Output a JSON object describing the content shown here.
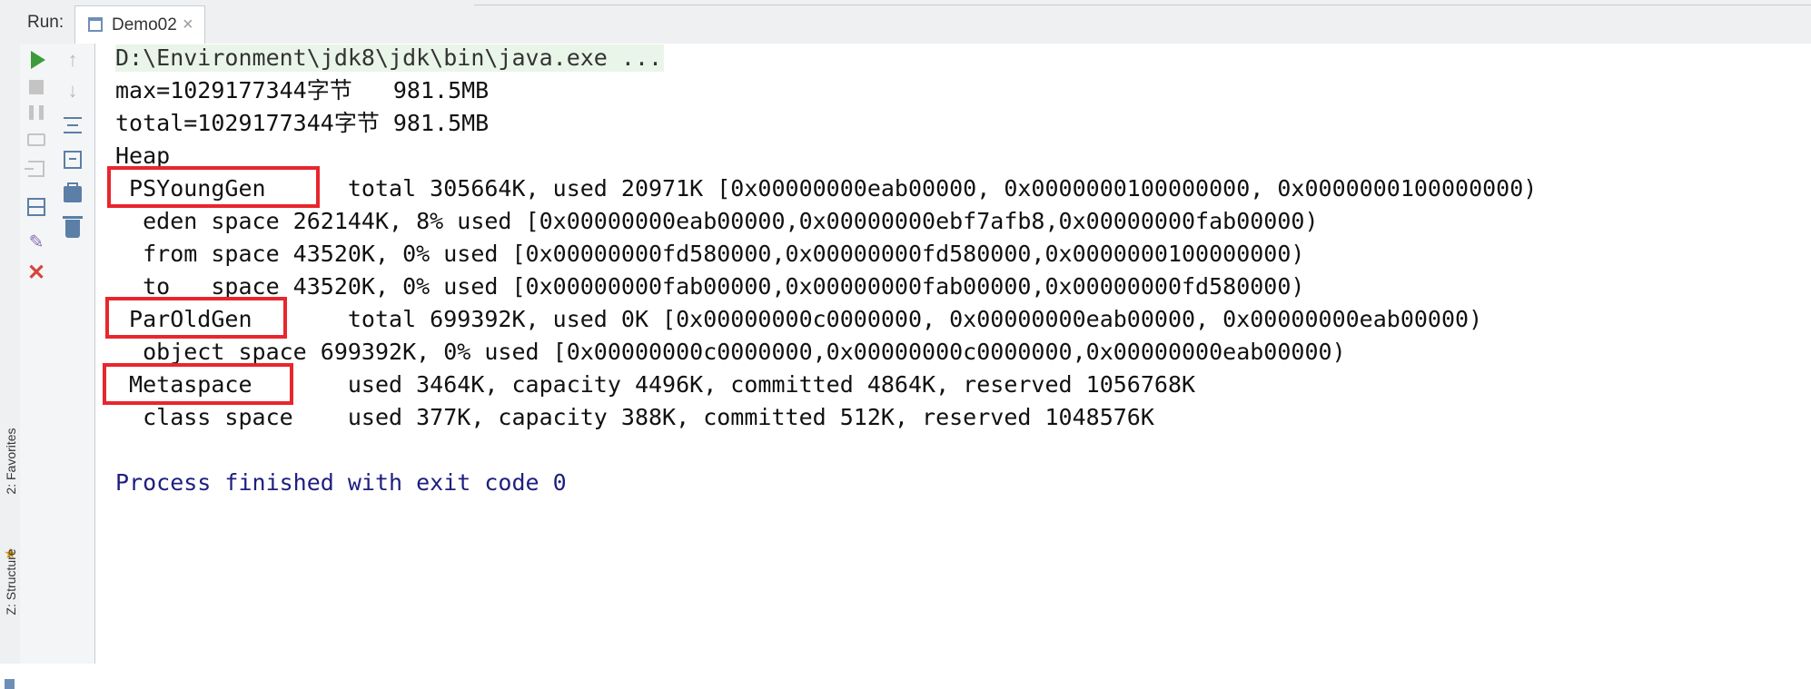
{
  "run_bar": {
    "label": "Run:",
    "tab_label": "Demo02",
    "tab_close": "×"
  },
  "side_tabs": {
    "favorites": "2: Favorites",
    "structure": "Z: Structure"
  },
  "toolbar_icons": [
    "play-icon",
    "stop-icon",
    "pause-icon",
    "camera-icon",
    "exit-icon",
    "layout-icon",
    "pin-icon",
    "close-icon",
    "arrow-up-icon",
    "arrow-down-icon",
    "soft-wrap-icon",
    "scroll-to-end-icon",
    "print-icon",
    "trash-icon"
  ],
  "colors": {
    "highlight_box": "#e8262d",
    "run_green": "#3d9b3d",
    "finish_text": "#1e1e80"
  },
  "console": {
    "lines": [
      "D:\\Environment\\jdk8\\jdk\\bin\\java.exe ...",
      "max=1029177344字节   981.5MB",
      "total=1029177344字节 981.5MB",
      "Heap",
      " PSYoungGen      total 305664K, used 20971K [0x00000000eab00000, 0x0000000100000000, 0x0000000100000000)",
      "  eden space 262144K, 8% used [0x00000000eab00000,0x00000000ebf7afb8,0x00000000fab00000)",
      "  from space 43520K, 0% used [0x00000000fd580000,0x00000000fd580000,0x0000000100000000)",
      "  to   space 43520K, 0% used [0x00000000fab00000,0x00000000fab00000,0x00000000fd580000)",
      " ParOldGen       total 699392K, used 0K [0x00000000c0000000, 0x00000000eab00000, 0x00000000eab00000)",
      "  object space 699392K, 0% used [0x00000000c0000000,0x00000000c0000000,0x00000000eab00000)",
      " Metaspace       used 3464K, capacity 4496K, committed 4864K, reserved 1056768K",
      "  class space    used 377K, capacity 388K, committed 512K, reserved 1048576K",
      "Process finished with exit code 0"
    ]
  }
}
